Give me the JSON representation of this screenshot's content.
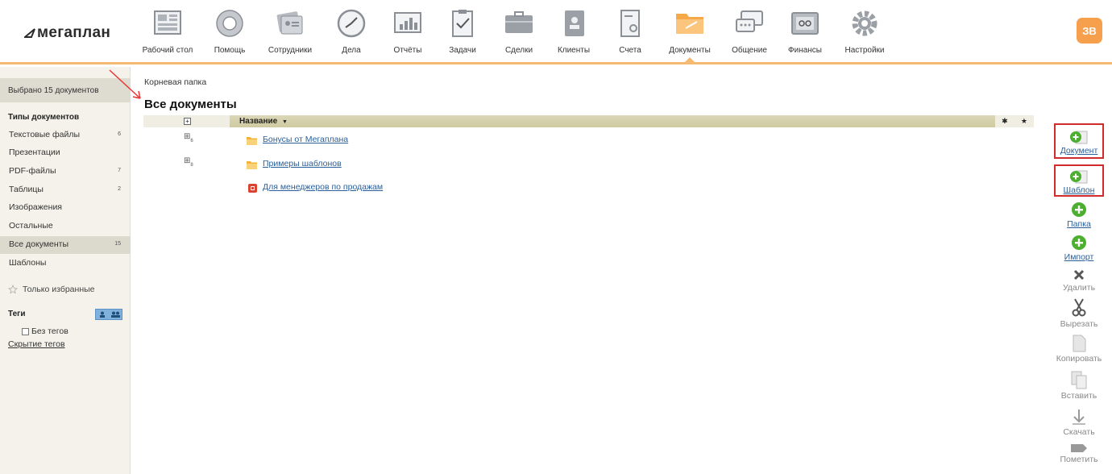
{
  "app": {
    "logo_text": "мегаплан",
    "avatar_initials": "ЗВ",
    "accent_color": "#f6a04d"
  },
  "nav": [
    {
      "key": "desktop",
      "label": "Рабочий стол",
      "icon": "desktop-icon"
    },
    {
      "key": "help",
      "label": "Помощь",
      "icon": "lifebuoy-icon"
    },
    {
      "key": "staff",
      "label": "Сотрудники",
      "icon": "staff-cards-icon"
    },
    {
      "key": "tasks-affairs",
      "label": "Дела",
      "icon": "clock-icon"
    },
    {
      "key": "reports",
      "label": "Отчёты",
      "icon": "bar-chart-icon"
    },
    {
      "key": "tasks",
      "label": "Задачи",
      "icon": "clipboard-check-icon"
    },
    {
      "key": "deals",
      "label": "Сделки",
      "icon": "briefcase-icon"
    },
    {
      "key": "clients",
      "label": "Клиенты",
      "icon": "contact-book-icon"
    },
    {
      "key": "invoices",
      "label": "Счета",
      "icon": "invoice-icon"
    },
    {
      "key": "documents",
      "label": "Документы",
      "icon": "folder-icon",
      "active": true
    },
    {
      "key": "chat",
      "label": "Общение",
      "icon": "chat-bubbles-icon"
    },
    {
      "key": "finance",
      "label": "Финансы",
      "icon": "safe-icon"
    },
    {
      "key": "settings",
      "label": "Настройки",
      "icon": "gear-icon"
    }
  ],
  "sidebar": {
    "selected_text": "Выбрано 15 документов",
    "types_heading": "Типы документов",
    "items": [
      {
        "label": "Текстовые файлы",
        "count": "6"
      },
      {
        "label": "Презентации",
        "count": ""
      },
      {
        "label": "PDF-файлы",
        "count": "7"
      },
      {
        "label": "Таблицы",
        "count": "2"
      },
      {
        "label": "Изображения",
        "count": ""
      },
      {
        "label": "Остальные",
        "count": ""
      },
      {
        "label": "Все документы",
        "count": "15",
        "active": true
      },
      {
        "label": "Шаблоны",
        "count": ""
      }
    ],
    "favorites_label": "Только избранные",
    "tags_heading": "Теги",
    "no_tags_label": "Без тегов",
    "hide_tags_label": "Скрытие тегов"
  },
  "main": {
    "breadcrumb": "Корневая папка",
    "title": "Все документы",
    "column_name": "Название",
    "rows": [
      {
        "name": "Бонусы от Мегаплана",
        "type": "folder",
        "count": "6"
      },
      {
        "name": "Примеры шаблонов",
        "type": "folder",
        "count": "8"
      },
      {
        "name": "Для менеджеров по продажам",
        "type": "document",
        "count": ""
      }
    ]
  },
  "actions": [
    {
      "key": "document",
      "label": "Документ",
      "icon": "add-document-icon",
      "style": "link",
      "boxed": true
    },
    {
      "key": "template",
      "label": "Шаблон",
      "icon": "add-template-icon",
      "style": "link",
      "boxed": true
    },
    {
      "key": "folder",
      "label": "Папка",
      "icon": "add-circle-icon",
      "style": "link",
      "boxed": false
    },
    {
      "key": "import",
      "label": "Импорт",
      "icon": "add-circle-icon",
      "style": "link",
      "boxed": false
    },
    {
      "key": "delete",
      "label": "Удалить",
      "icon": "delete-x-icon",
      "style": "dim",
      "boxed": false
    },
    {
      "key": "cut",
      "label": "Вырезать",
      "icon": "scissors-icon",
      "style": "dim",
      "boxed": false
    },
    {
      "key": "copy",
      "label": "Копировать",
      "icon": "copy-icon",
      "style": "dim",
      "boxed": false
    },
    {
      "key": "paste",
      "label": "Вставить",
      "icon": "paste-icon",
      "style": "dim",
      "boxed": false
    },
    {
      "key": "download",
      "label": "Скачать",
      "icon": "download-arrow-icon",
      "style": "dim",
      "boxed": false
    },
    {
      "key": "mark",
      "label": "Пометить",
      "icon": "tag-label-icon",
      "style": "dim",
      "boxed": false
    }
  ]
}
